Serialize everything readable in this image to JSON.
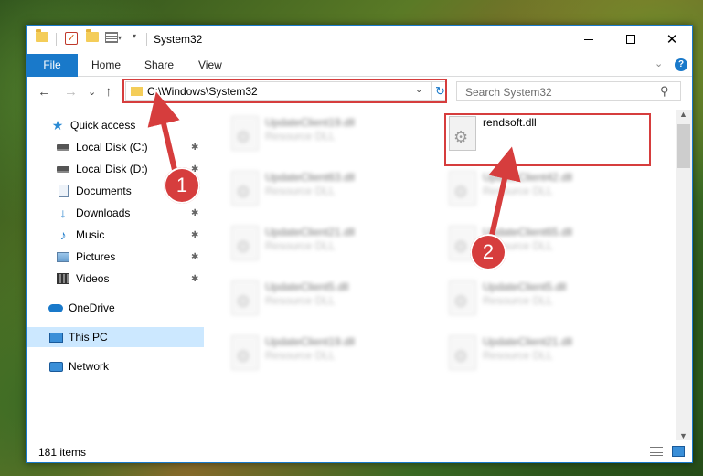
{
  "window": {
    "title": "System32",
    "controls": {
      "minimize": "",
      "maximize": "",
      "close": "✕"
    }
  },
  "quick_access_toolbar": {
    "dropdown": "▾"
  },
  "ribbon": {
    "file_tab": "File",
    "tabs": [
      "Home",
      "Share",
      "View"
    ],
    "collapse": "⌄",
    "help": "?"
  },
  "navigation": {
    "back": "←",
    "forward": "→",
    "recent": "⌄",
    "up": "↑"
  },
  "address_bar": {
    "path": "C:\\Windows\\System32",
    "dropdown": "⌄",
    "refresh": "↻"
  },
  "search": {
    "placeholder": "Search System32",
    "icon": "search-icon"
  },
  "sidebar": {
    "items": [
      {
        "label": "Quick access",
        "icon": "star-icon",
        "pinned": false
      },
      {
        "label": "Local Disk (C:)",
        "icon": "disk-icon",
        "pinned": true
      },
      {
        "label": "Local Disk (D:)",
        "icon": "disk-icon",
        "pinned": true
      },
      {
        "label": "Documents",
        "icon": "document-icon",
        "pinned": true
      },
      {
        "label": "Downloads",
        "icon": "download-icon",
        "pinned": true
      },
      {
        "label": "Music",
        "icon": "music-icon",
        "pinned": true
      },
      {
        "label": "Pictures",
        "icon": "pictures-icon",
        "pinned": true
      },
      {
        "label": "Videos",
        "icon": "videos-icon",
        "pinned": true
      },
      {
        "label": "OneDrive",
        "icon": "cloud-icon",
        "pinned": false
      },
      {
        "label": "This PC",
        "icon": "computer-icon",
        "pinned": false,
        "selected": true
      },
      {
        "label": "Network",
        "icon": "network-icon",
        "pinned": false
      }
    ],
    "pin_glyph": "📌"
  },
  "files": {
    "left_column": [
      {
        "name": "UpdateClient19.dll",
        "type": "Resource DLL"
      },
      {
        "name": "UpdateClient63.dll",
        "type": "Resource DLL"
      },
      {
        "name": "UpdateClient21.dll",
        "type": "Resource DLL"
      },
      {
        "name": "UpdateClient5.dll",
        "type": "Resource DLL"
      },
      {
        "name": "UpdateClient19.dll",
        "type": "Resource DLL"
      }
    ],
    "right_column": [
      {
        "name": "rendsoft.dll",
        "type": "",
        "highlighted": true
      },
      {
        "name": "UpdateClient42.dll",
        "type": "Resource DLL"
      },
      {
        "name": "UpdateClient65.dll",
        "type": "Resource DLL"
      },
      {
        "name": "UpdateClient5.dll",
        "type": "Resource DLL"
      },
      {
        "name": "UpdateClient21.dll",
        "type": "Resource DLL"
      }
    ]
  },
  "status": {
    "item_count": "181 items"
  },
  "annotations": {
    "step1": "1",
    "step2": "2",
    "color": "#d63d3d"
  },
  "colors": {
    "accent": "#1979ca",
    "selection": "#cce8ff",
    "annotation": "#d63d3d"
  }
}
